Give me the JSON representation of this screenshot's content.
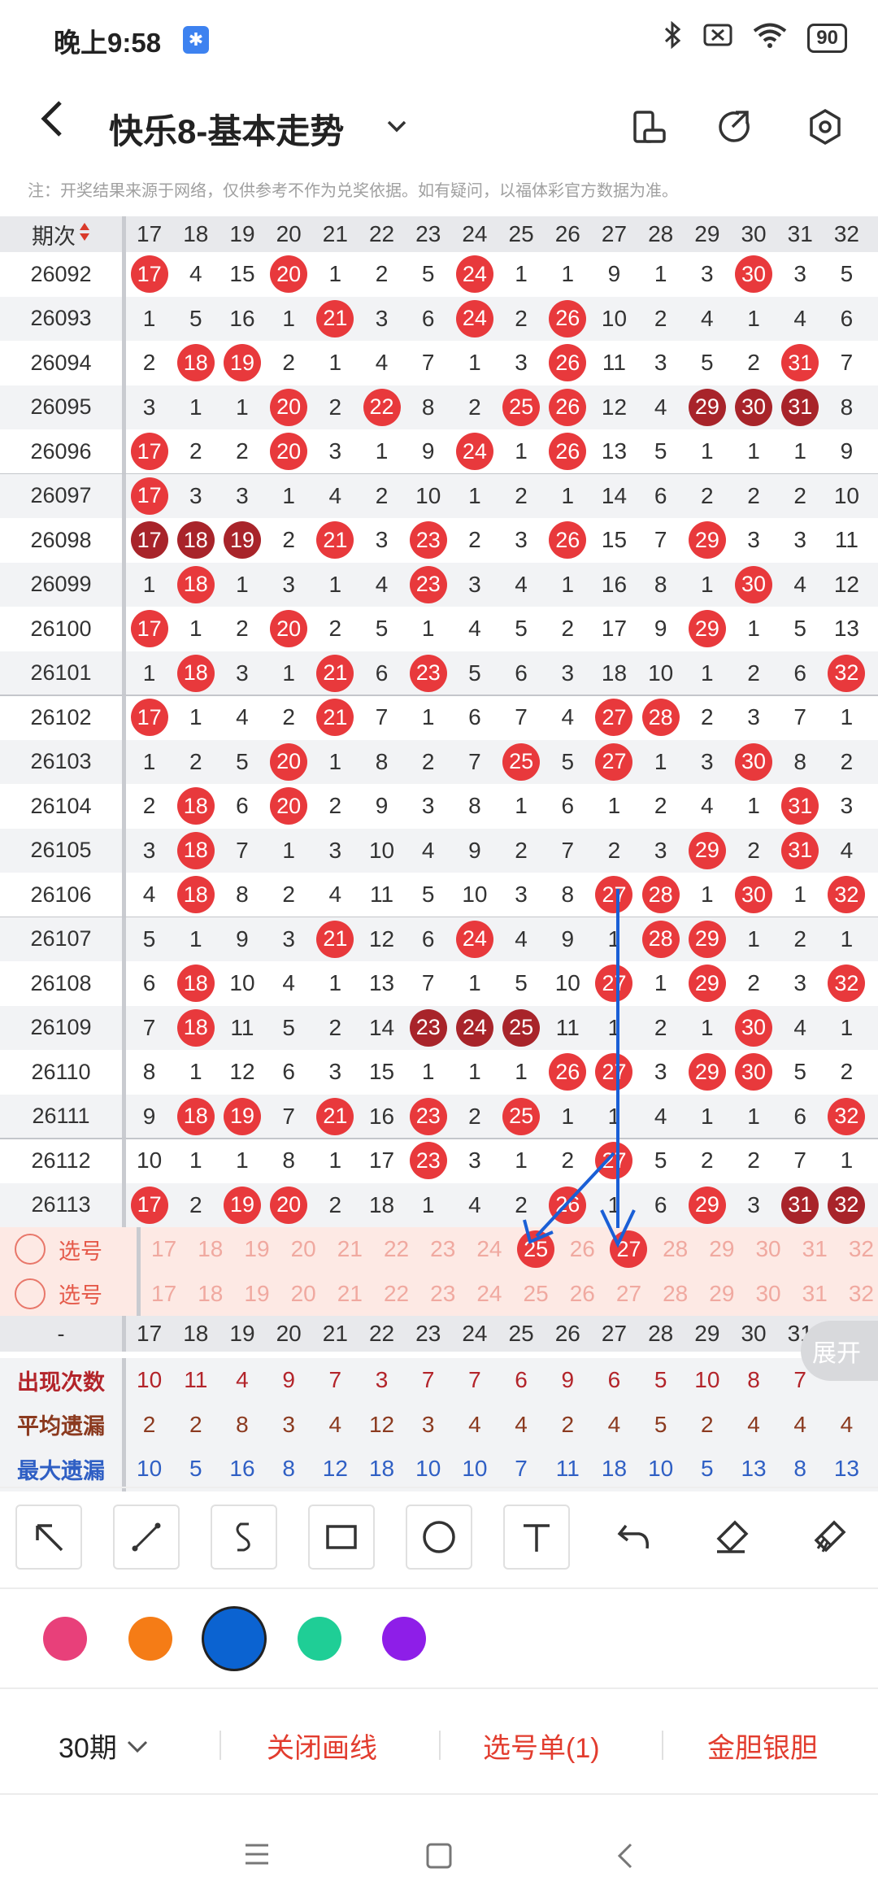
{
  "status_bar": {
    "time": "晚上9:58",
    "battery": "90"
  },
  "header": {
    "title": "快乐8-基本走势"
  },
  "notice": "注：开奖结果来源于网络，仅供参考不作为兑奖依据。如有疑问，以福体彩官方数据为准。",
  "table": {
    "period_header": "期次",
    "columns": [
      "17",
      "18",
      "19",
      "20",
      "21",
      "22",
      "23",
      "24",
      "25",
      "26",
      "27",
      "28",
      "29",
      "30",
      "31",
      "32"
    ],
    "rows": [
      {
        "period": "26092",
        "cells": [
          "17",
          "4",
          "15",
          "20",
          "1",
          "2",
          "5",
          "24",
          "1",
          "1",
          "9",
          "1",
          "3",
          "30",
          "3",
          "5"
        ]
      },
      {
        "period": "26093",
        "cells": [
          "1",
          "5",
          "16",
          "1",
          "21",
          "3",
          "6",
          "24",
          "2",
          "26",
          "10",
          "2",
          "4",
          "1",
          "4",
          "6"
        ]
      },
      {
        "period": "26094",
        "cells": [
          "2",
          "18",
          "19",
          "2",
          "1",
          "4",
          "7",
          "1",
          "3",
          "26",
          "11",
          "3",
          "5",
          "2",
          "31",
          "7"
        ]
      },
      {
        "period": "26095",
        "cells": [
          "3",
          "1",
          "1",
          "20",
          "2",
          "22",
          "8",
          "2",
          "25",
          "26",
          "12",
          "4",
          "29",
          "30",
          "31",
          "8"
        ]
      },
      {
        "period": "26096",
        "cells": [
          "17",
          "2",
          "2",
          "20",
          "3",
          "1",
          "9",
          "24",
          "1",
          "26",
          "13",
          "5",
          "1",
          "1",
          "1",
          "9"
        ]
      },
      {
        "period": "26097",
        "cells": [
          "17",
          "3",
          "3",
          "1",
          "4",
          "2",
          "10",
          "1",
          "2",
          "1",
          "14",
          "6",
          "2",
          "2",
          "2",
          "10"
        ]
      },
      {
        "period": "26098",
        "cells": [
          "17",
          "18",
          "19",
          "2",
          "21",
          "3",
          "23",
          "2",
          "3",
          "26",
          "15",
          "7",
          "29",
          "3",
          "3",
          "11"
        ]
      },
      {
        "period": "26099",
        "cells": [
          "1",
          "18",
          "1",
          "3",
          "1",
          "4",
          "23",
          "3",
          "4",
          "1",
          "16",
          "8",
          "1",
          "30",
          "4",
          "12"
        ]
      },
      {
        "period": "26100",
        "cells": [
          "17",
          "1",
          "2",
          "20",
          "2",
          "5",
          "1",
          "4",
          "5",
          "2",
          "17",
          "9",
          "29",
          "1",
          "5",
          "13"
        ]
      },
      {
        "period": "26101",
        "cells": [
          "1",
          "18",
          "3",
          "1",
          "21",
          "6",
          "23",
          "5",
          "6",
          "3",
          "18",
          "10",
          "1",
          "2",
          "6",
          "32"
        ]
      },
      {
        "period": "26102",
        "cells": [
          "17",
          "1",
          "4",
          "2",
          "21",
          "7",
          "1",
          "6",
          "7",
          "4",
          "27",
          "28",
          "2",
          "3",
          "7",
          "1"
        ]
      },
      {
        "period": "26103",
        "cells": [
          "1",
          "2",
          "5",
          "20",
          "1",
          "8",
          "2",
          "7",
          "25",
          "5",
          "27",
          "1",
          "3",
          "30",
          "8",
          "2"
        ]
      },
      {
        "period": "26104",
        "cells": [
          "2",
          "18",
          "6",
          "20",
          "2",
          "9",
          "3",
          "8",
          "1",
          "6",
          "1",
          "2",
          "4",
          "1",
          "31",
          "3"
        ]
      },
      {
        "period": "26105",
        "cells": [
          "3",
          "18",
          "7",
          "1",
          "3",
          "10",
          "4",
          "9",
          "2",
          "7",
          "2",
          "3",
          "29",
          "2",
          "31",
          "4"
        ]
      },
      {
        "period": "26106",
        "cells": [
          "4",
          "18",
          "8",
          "2",
          "4",
          "11",
          "5",
          "10",
          "3",
          "8",
          "27",
          "28",
          "1",
          "30",
          "1",
          "32"
        ]
      },
      {
        "period": "26107",
        "cells": [
          "5",
          "1",
          "9",
          "3",
          "21",
          "12",
          "6",
          "24",
          "4",
          "9",
          "1",
          "28",
          "29",
          "1",
          "2",
          "1"
        ]
      },
      {
        "period": "26108",
        "cells": [
          "6",
          "18",
          "10",
          "4",
          "1",
          "13",
          "7",
          "1",
          "5",
          "10",
          "27",
          "1",
          "29",
          "2",
          "3",
          "32"
        ]
      },
      {
        "period": "26109",
        "cells": [
          "7",
          "18",
          "11",
          "5",
          "2",
          "14",
          "23",
          "24",
          "25",
          "11",
          "1",
          "2",
          "1",
          "30",
          "4",
          "1"
        ]
      },
      {
        "period": "26110",
        "cells": [
          "8",
          "1",
          "12",
          "6",
          "3",
          "15",
          "1",
          "1",
          "1",
          "26",
          "27",
          "3",
          "29",
          "30",
          "5",
          "2"
        ]
      },
      {
        "period": "26111",
        "cells": [
          "9",
          "18",
          "19",
          "7",
          "21",
          "16",
          "23",
          "2",
          "25",
          "1",
          "1",
          "4",
          "1",
          "1",
          "6",
          "32"
        ]
      },
      {
        "period": "26112",
        "cells": [
          "10",
          "1",
          "1",
          "8",
          "1",
          "17",
          "23",
          "3",
          "1",
          "2",
          "27",
          "5",
          "2",
          "2",
          "7",
          "1"
        ]
      },
      {
        "period": "26113",
        "cells": [
          "17",
          "2",
          "19",
          "20",
          "2",
          "18",
          "1",
          "4",
          "2",
          "26",
          "1",
          "6",
          "29",
          "3",
          "31",
          "32"
        ]
      }
    ],
    "dark_balls": [
      [
        3,
        "29"
      ],
      [
        3,
        "30"
      ],
      [
        3,
        "31"
      ],
      [
        6,
        "17"
      ],
      [
        6,
        "18"
      ],
      [
        6,
        "19"
      ],
      [
        17,
        "23"
      ],
      [
        17,
        "24"
      ],
      [
        17,
        "25"
      ],
      [
        21,
        "31"
      ],
      [
        21,
        "32"
      ]
    ],
    "pick_rows": [
      {
        "label": "选号",
        "selected": [
          "25",
          "27"
        ]
      },
      {
        "label": "选号",
        "selected": []
      }
    ],
    "footer_label": "-",
    "stats": [
      {
        "label": "出现次数",
        "color": "#b3242a",
        "values": [
          "10",
          "11",
          "4",
          "9",
          "7",
          "3",
          "7",
          "7",
          "6",
          "9",
          "6",
          "5",
          "10",
          "8",
          "7",
          ""
        ]
      },
      {
        "label": "平均遗漏",
        "color": "#8b3a1f",
        "values": [
          "2",
          "2",
          "8",
          "3",
          "4",
          "12",
          "3",
          "4",
          "4",
          "2",
          "4",
          "5",
          "2",
          "4",
          "4",
          "4"
        ]
      },
      {
        "label": "最大遗漏",
        "color": "#2f5fc4",
        "values": [
          "10",
          "5",
          "16",
          "8",
          "12",
          "18",
          "10",
          "10",
          "7",
          "11",
          "18",
          "10",
          "5",
          "13",
          "8",
          "13"
        ]
      }
    ],
    "expand_label": "展开"
  },
  "draw_tools": [
    "arrow-tool",
    "line-tool",
    "curve-tool",
    "rect-tool",
    "circle-tool",
    "text-tool",
    "undo-tool",
    "eraser-tool",
    "clear-tool"
  ],
  "draw_colors": [
    "#e8407a",
    "#f57c16",
    "#0b63d1",
    "#1fce96",
    "#8e1ee8"
  ],
  "selected_color": "#0b63d1",
  "bottom_bar": {
    "period_select": "30期",
    "close_draw": "关闭画线",
    "pick_list": "选号单(1)",
    "gold_silver": "金胆银胆"
  }
}
